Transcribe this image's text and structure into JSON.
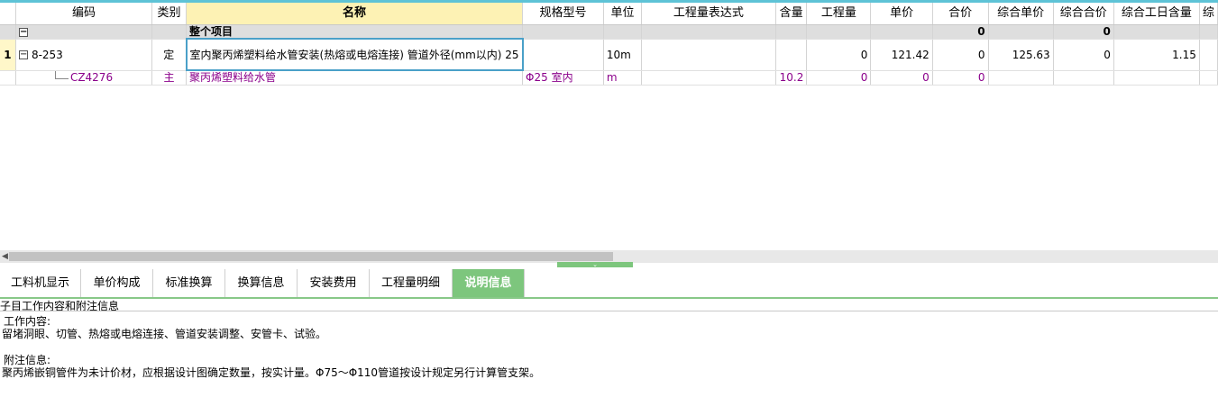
{
  "columns": {
    "code": "编码",
    "type": "类别",
    "name": "名称",
    "spec": "规格型号",
    "unit": "单位",
    "expr": "工程量表达式",
    "content": "含量",
    "qty": "工程量",
    "price": "单价",
    "total": "合价",
    "comp_price": "综合单价",
    "comp_total": "综合合价",
    "labor": "综合工日含量",
    "extra": "综"
  },
  "total_row": {
    "toggle": "−",
    "name": "整个项目",
    "total": "0",
    "comp_total": "0"
  },
  "row1": {
    "num": "1",
    "toggle": "−",
    "code": "8-253",
    "type": "定",
    "name": "室内聚丙烯塑料给水管安装(热熔或电熔连接) 管道外径(mm以内) 25",
    "spec": "",
    "unit": "10m",
    "expr": "",
    "content": "",
    "qty": "0",
    "price": "121.42",
    "total": "0",
    "comp_price": "125.63",
    "comp_total": "0",
    "labor": "1.15"
  },
  "row2": {
    "code": "CZ4276",
    "type": "主",
    "name": "聚丙烯塑料给水管",
    "spec": "Φ25 室内",
    "unit": "m",
    "expr": "",
    "content": "10.2",
    "qty": "0",
    "price": "0",
    "total": "0"
  },
  "scroll": {
    "left_arrow": "◀"
  },
  "splitter_icon": "⌄",
  "tabs": [
    "工料机显示",
    "单价构成",
    "标准换算",
    "换算信息",
    "安装费用",
    "工程量明细",
    "说明信息"
  ],
  "panel": {
    "title": "子目工作内容和附注信息",
    "work_label": "工作内容:",
    "work_text": "留堵洞眼、切管、热熔或电熔连接、管道安装调整、安管卡、试验。",
    "note_label": "附注信息:",
    "note_text": "聚丙烯嵌铜管件为未计价材，应根据设计图确定数量，按实计量。Φ75～Φ110管道按设计规定另行计算管支架。"
  }
}
